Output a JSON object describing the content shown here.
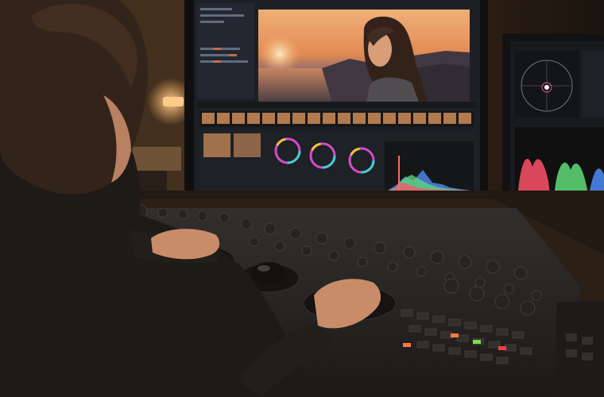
{
  "scene": {
    "subject": "colorist-at-grading-console",
    "palette": {
      "warm_ambient": "#c98a4b",
      "screen_sky_top": "#f0a868",
      "screen_sky_bottom": "#5a4a6a",
      "ui_panel": "#1b2028",
      "ui_dark": "#10141a",
      "hist_red": "#ff4f6a",
      "hist_green": "#5be07a",
      "hist_blue": "#4a8cff"
    },
    "icons": [
      "color-wheel-icon",
      "trackball-icon",
      "vectorscope-icon"
    ]
  }
}
